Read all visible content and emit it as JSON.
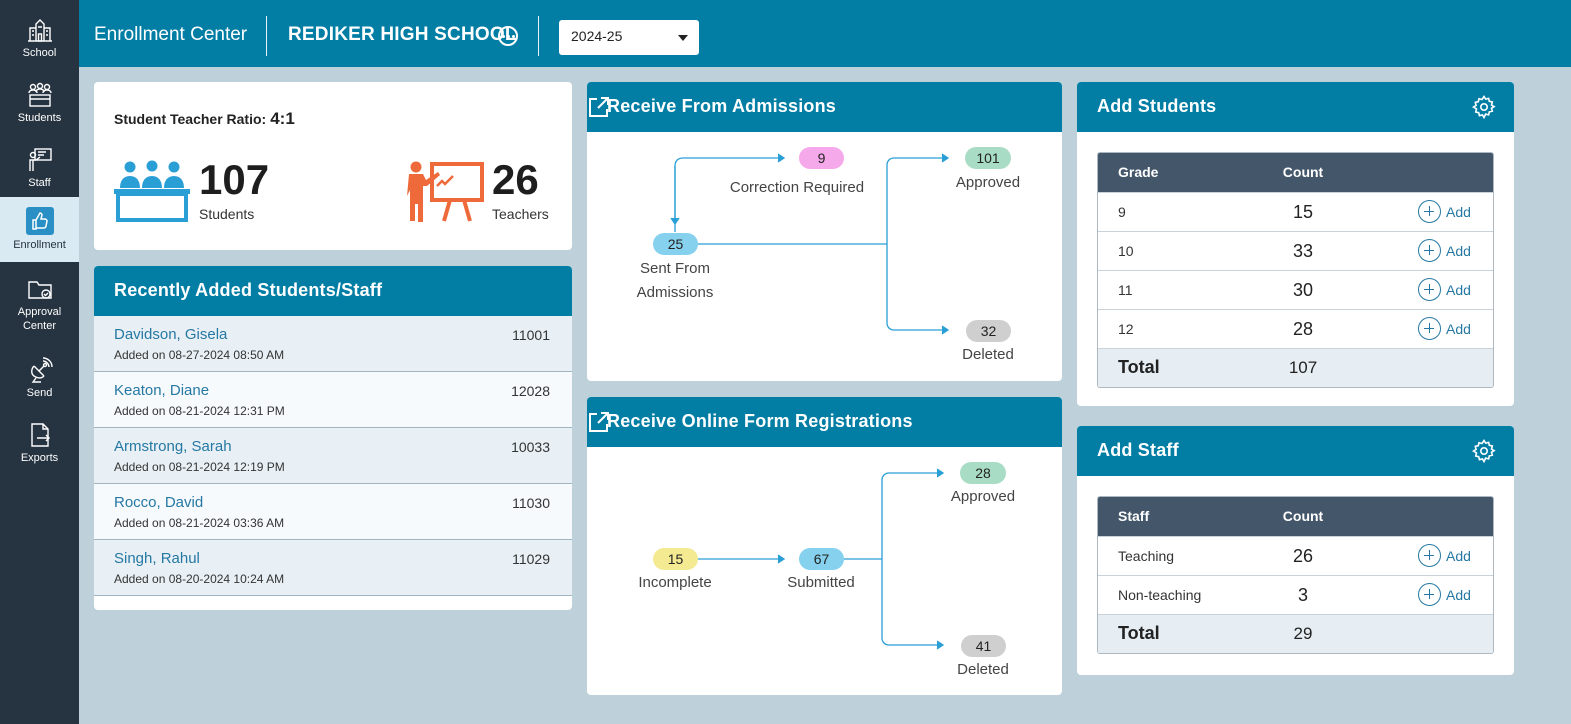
{
  "sidebar": {
    "items": [
      {
        "label": "School",
        "icon": "school-icon"
      },
      {
        "label": "Students",
        "icon": "students-icon"
      },
      {
        "label": "Staff",
        "icon": "staff-icon"
      },
      {
        "label": "Enrollment",
        "icon": "thumbs-up-icon",
        "active": true
      },
      {
        "label": "Approval Center",
        "icon": "folder-approval-icon"
      },
      {
        "label": "Send",
        "icon": "satellite-icon"
      },
      {
        "label": "Exports",
        "icon": "export-file-icon"
      }
    ]
  },
  "header": {
    "app_title": "Enrollment Center",
    "school_name": "REDIKER HIGH SCHOOL",
    "year": "2024-25"
  },
  "ratio_card": {
    "label": "Student Teacher Ratio:",
    "ratio": "4:1",
    "students_count": "107",
    "students_label": "Students",
    "teachers_count": "26",
    "teachers_label": "Teachers"
  },
  "recent": {
    "title": "Recently Added Students/Staff",
    "rows": [
      {
        "name": "Davidson, Gisela",
        "id": "11001",
        "date": "Added on 08-27-2024 08:50 AM"
      },
      {
        "name": "Keaton, Diane",
        "id": "12028",
        "date": "Added on 08-21-2024 12:31 PM"
      },
      {
        "name": "Armstrong, Sarah",
        "id": "10033",
        "date": "Added on 08-21-2024 12:19 PM"
      },
      {
        "name": "Rocco, David",
        "id": "11030",
        "date": "Added on 08-21-2024 03:36 AM"
      },
      {
        "name": "Singh, Rahul",
        "id": "11029",
        "date": "Added on 08-20-2024 10:24 AM"
      }
    ]
  },
  "admissions": {
    "title": "Receive From Admissions",
    "correction": {
      "count": "9",
      "label": "Correction Required"
    },
    "sent": {
      "count": "25",
      "label_line1": "Sent From",
      "label_line2": "Admissions"
    },
    "approved": {
      "count": "101",
      "label": "Approved"
    },
    "deleted": {
      "count": "32",
      "label": "Deleted"
    }
  },
  "online": {
    "title": "Receive Online Form Registrations",
    "incomplete": {
      "count": "15",
      "label": "Incomplete"
    },
    "submitted": {
      "count": "67",
      "label": "Submitted"
    },
    "approved": {
      "count": "28",
      "label": "Approved"
    },
    "deleted": {
      "count": "41",
      "label": "Deleted"
    }
  },
  "add_students": {
    "title": "Add Students",
    "col1": "Grade",
    "col2": "Count",
    "add_label": "Add",
    "rows": [
      {
        "grade": "9",
        "count": "15"
      },
      {
        "grade": "10",
        "count": "33"
      },
      {
        "grade": "11",
        "count": "30"
      },
      {
        "grade": "12",
        "count": "28"
      }
    ],
    "total_label": "Total",
    "total": "107"
  },
  "add_staff": {
    "title": "Add Staff",
    "col1": "Staff",
    "col2": "Count",
    "add_label": "Add",
    "rows": [
      {
        "type": "Teaching",
        "count": "26"
      },
      {
        "type": "Non-teaching",
        "count": "3"
      }
    ],
    "total_label": "Total",
    "total": "29"
  },
  "colors": {
    "brand": "#027ea5",
    "sidebar": "#263340",
    "pill_blue": "#86d1ee",
    "pill_pink": "#f6a9ea",
    "pill_green": "#a9dcc4",
    "pill_gray": "#cfcfcf",
    "pill_yellow": "#f3ea92",
    "icon_orange": "#ee6a3a",
    "icon_blue": "#2a9fd6"
  }
}
